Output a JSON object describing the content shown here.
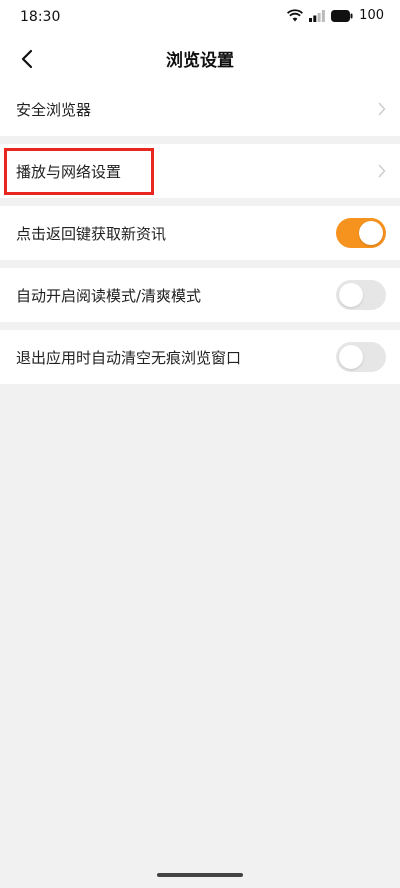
{
  "status_bar": {
    "time": "18:30",
    "battery": "100",
    "icons": [
      "wifi-icon",
      "signal-icon",
      "battery-icon"
    ]
  },
  "header": {
    "title": "浏览设置",
    "back_icon": "chevron-left-icon"
  },
  "settings": {
    "items": [
      {
        "label": "安全浏览器",
        "control": "chevron"
      },
      {
        "label": "播放与网络设置",
        "control": "chevron",
        "highlighted": true
      },
      {
        "label": "点击返回键获取新资讯",
        "control": "toggle",
        "enabled": true
      },
      {
        "label": "自动开启阅读模式/清爽模式",
        "control": "toggle",
        "enabled": false
      },
      {
        "label": "退出应用时自动清空无痕浏览窗口",
        "control": "toggle",
        "enabled": false
      }
    ]
  },
  "colors": {
    "accent": "#f6921e",
    "highlight_border": "#e8281e",
    "background": "#f1f1f1",
    "toggle_off": "#e6e6e6"
  }
}
